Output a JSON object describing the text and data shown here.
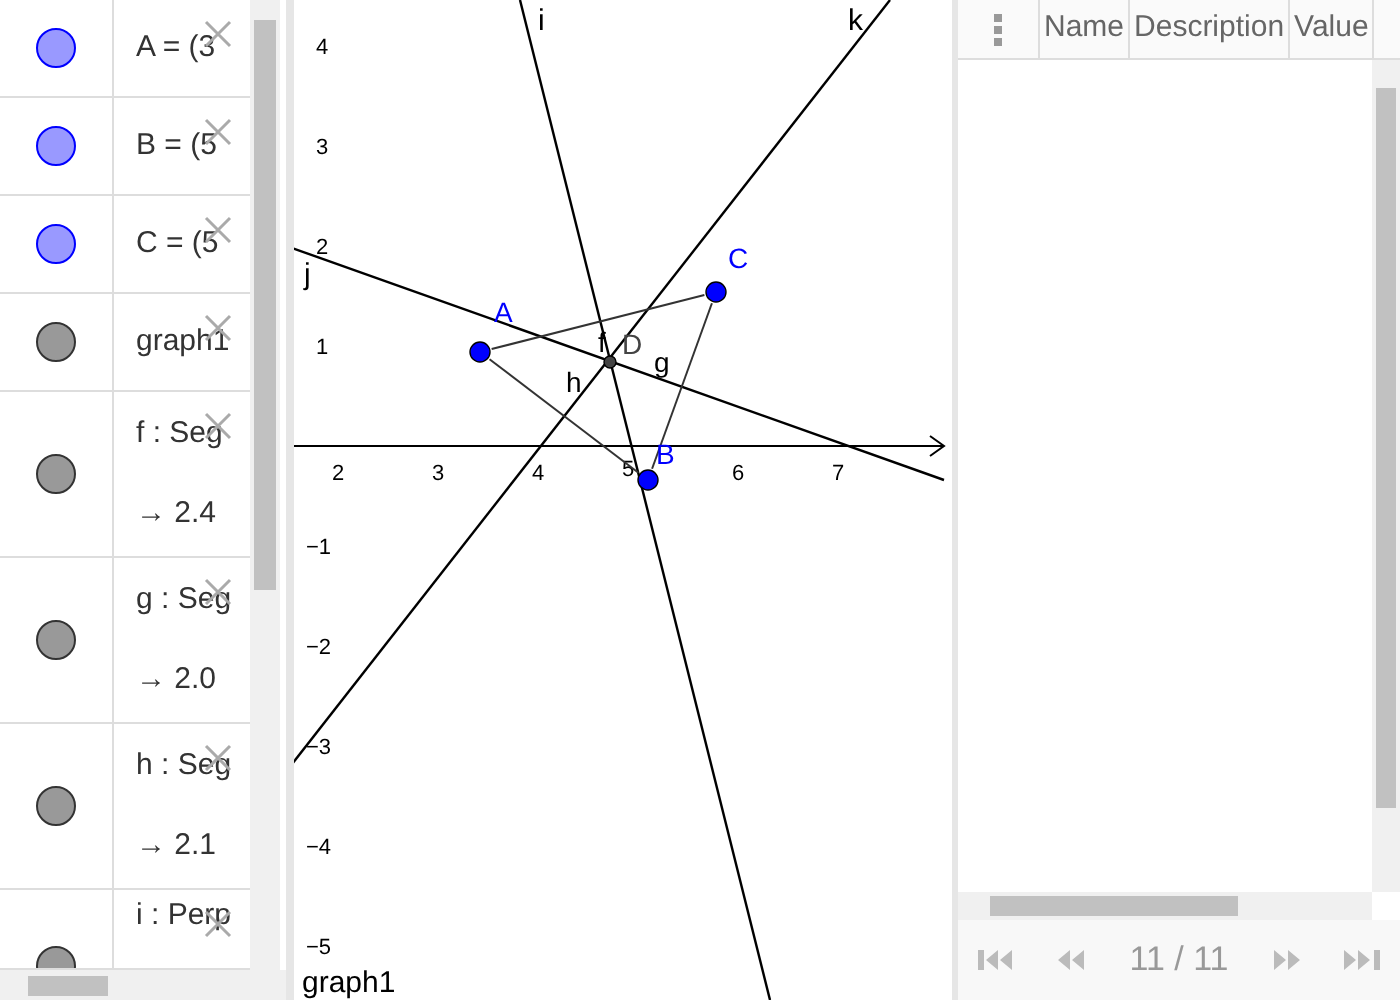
{
  "algebra": {
    "items": [
      {
        "kind": "point",
        "color": "#9999ff",
        "text": "A = (3"
      },
      {
        "kind": "point",
        "color": "#9999ff",
        "text": "B = (5"
      },
      {
        "kind": "point",
        "color": "#9999ff",
        "text": "C = (5"
      },
      {
        "kind": "graph",
        "color": "#999999",
        "text": "graph1"
      },
      {
        "kind": "segment",
        "color": "#999999",
        "text": "f : Seg",
        "value": "→ 2.4"
      },
      {
        "kind": "segment",
        "color": "#999999",
        "text": "g : Seg",
        "value": "→ 2.0"
      },
      {
        "kind": "segment",
        "color": "#999999",
        "text": "h : Seg",
        "value": "→ 2.1"
      },
      {
        "kind": "line",
        "color": "#999999",
        "text": "i : Perp"
      }
    ]
  },
  "graphics": {
    "points": [
      {
        "label": "A",
        "color": "#0000ff"
      },
      {
        "label": "B",
        "color": "#0000ff"
      },
      {
        "label": "C",
        "color": "#0000ff"
      },
      {
        "label": "D",
        "color": "#444444"
      }
    ],
    "lines": [
      {
        "label": "i"
      },
      {
        "label": "k"
      },
      {
        "label": "j"
      }
    ],
    "segments": [
      {
        "label": "f"
      },
      {
        "label": "g"
      },
      {
        "label": "h"
      }
    ],
    "x_ticks": [
      "2",
      "3",
      "4",
      "5",
      "6",
      "7"
    ],
    "y_ticks": [
      "4",
      "3",
      "2",
      "1",
      "−1",
      "−2",
      "−3",
      "−4",
      "−5"
    ],
    "caption": "graph1"
  },
  "table": {
    "columns": [
      "Name",
      "Description",
      "Value"
    ],
    "pager": "11 / 11"
  }
}
